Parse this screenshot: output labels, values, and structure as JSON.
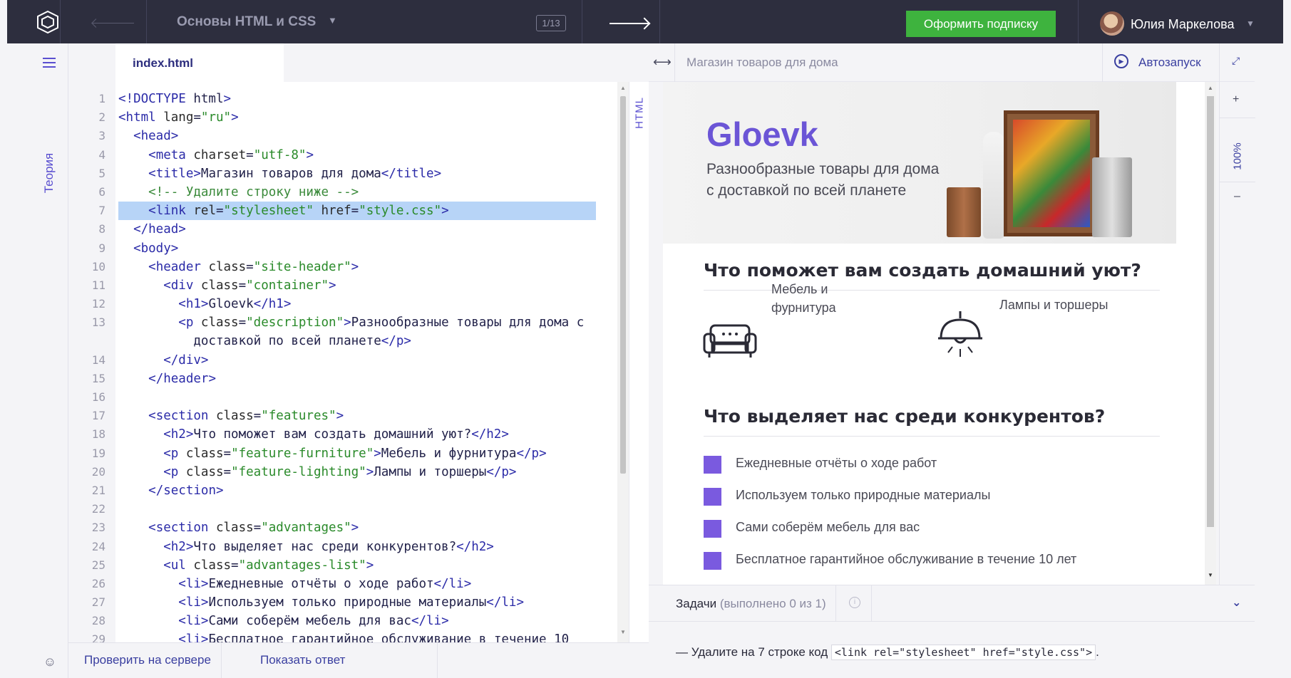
{
  "topbar": {
    "course_title": "Основы HTML и CSS",
    "progress": "1/13",
    "subscribe_label": "Оформить подписку",
    "user_name": "Юлия Маркелова"
  },
  "sidebar": {
    "theory_label": "Теория"
  },
  "editor": {
    "file_tab": "index.html",
    "lang_label": "HTML",
    "highlighted_line": 7,
    "lines": [
      "<!DOCTYPE html>",
      "<html lang=\"ru\">",
      "  <head>",
      "    <meta charset=\"utf-8\">",
      "    <title>Магазин товаров для дома</title>",
      "    <!-- Удалите строку ниже -->",
      "    <link rel=\"stylesheet\" href=\"style.css\">",
      "  </head>",
      "  <body>",
      "    <header class=\"site-header\">",
      "      <div class=\"container\">",
      "        <h1>Gloevk</h1>",
      "        <p class=\"description\">Разнообразные товары для дома с",
      "          доставкой по всей планете</p>",
      "      </div>",
      "    </header>",
      "",
      "    <section class=\"features\">",
      "      <h2>Что поможет вам создать домашний уют?</h2>",
      "      <p class=\"feature-furniture\">Мебель и фурнитура</p>",
      "      <p class=\"feature-lighting\">Лампы и торшеры</p>",
      "    </section>",
      "",
      "    <section class=\"advantages\">",
      "      <h2>Что выделяет нас среди конкурентов?</h2>",
      "      <ul class=\"advantages-list\">",
      "        <li>Ежедневные отчёты о ходе работ</li>",
      "        <li>Используем только природные материалы</li>",
      "        <li>Сами соберём мебель для вас</li>",
      "        <li>Бесплатное гарантийное обслуживание в течение 10"
    ],
    "line_numbers": [
      "1",
      "2",
      "3",
      "4",
      "5",
      "6",
      "7",
      "8",
      "9",
      "10",
      "11",
      "12",
      "13",
      "",
      "14",
      "15",
      "16",
      "17",
      "18",
      "19",
      "20",
      "21",
      "22",
      "23",
      "24",
      "25",
      "26",
      "27",
      "28",
      "29"
    ]
  },
  "actions": {
    "check_label": "Проверить на сервере",
    "answer_label": "Показать ответ"
  },
  "preview": {
    "title": "Магазин товаров для дома",
    "autorun_label": "Автозапуск",
    "zoom_level": "100%",
    "zoom_plus": "+",
    "zoom_minus": "–",
    "brand": "Gloevk",
    "tagline": "Разнообразные товары для дома с доставкой по всей планете",
    "features_title": "Что поможет вам создать домашний уют?",
    "feature_furniture": "Мебель и фурнитура",
    "feature_lighting": "Лампы и торшеры",
    "advantages_title": "Что выделяет нас среди конкурентов?",
    "advantages": [
      "Ежедневные отчёты о ходе работ",
      "Используем только природные материалы",
      "Сами соберём мебель для вас",
      "Бесплатное гарантийное обслуживание в течение 10 лет"
    ],
    "accent_color": "#7a5adf"
  },
  "tasks": {
    "label": "Задачи",
    "count": "(выполнено 0 из 1)",
    "task_prefix": "—  Удалите на 7 строке код",
    "task_code": "<link rel=\"stylesheet\" href=\"style.css\">",
    "task_suffix": "."
  },
  "colors": {
    "topbar": "#2d2e3e",
    "subscribe": "#3eb33e",
    "accent": "#5a4fd0",
    "highlight": "#b7d4f7"
  },
  "icons": [
    "logo-icon",
    "back-arrow-icon",
    "chevron-down-icon",
    "forward-arrow-icon",
    "hamburger-icon",
    "feedback-icon",
    "expand-icon",
    "autorun-icon",
    "fullscreen-icon",
    "sofa-icon",
    "lamp-icon",
    "info-icon",
    "collapse-icon"
  ]
}
